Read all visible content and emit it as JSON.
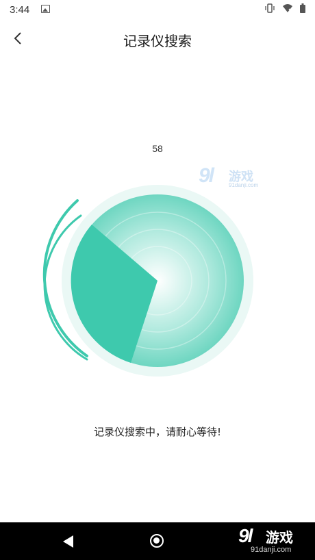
{
  "status_bar": {
    "time": "3:44",
    "left_icons": [
      "image-icon"
    ],
    "right_icons": [
      "vibrate-icon",
      "wifi-off-icon",
      "battery-icon"
    ]
  },
  "header": {
    "title": "记录仪搜索",
    "back_icon": "chevron-left-icon"
  },
  "search": {
    "count": "58",
    "status_text": "记录仪搜索中，请耐心等待!"
  },
  "colors": {
    "accent": "#3ec9ad",
    "radar_light": "#e6f7f3",
    "nav_bar": "#000000"
  },
  "watermark": {
    "number": "9l",
    "text": "游戏",
    "url": "91danji.com"
  }
}
